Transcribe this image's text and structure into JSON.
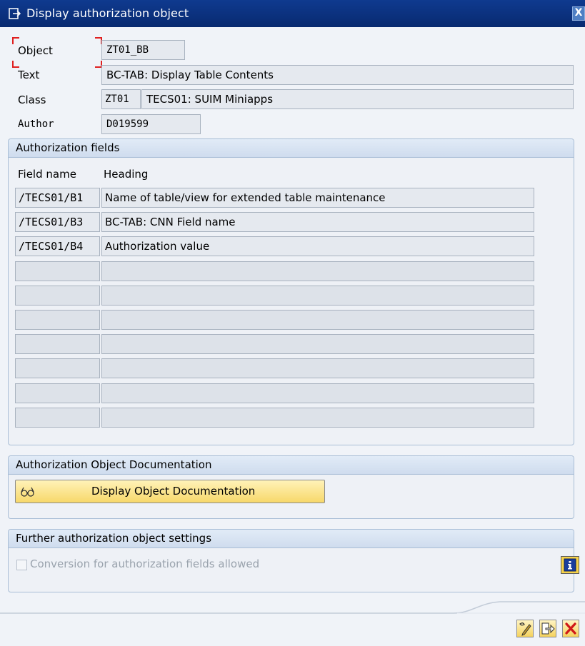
{
  "window": {
    "title": "Display authorization object",
    "close_label": "X"
  },
  "header": {
    "object_label": "Object",
    "object_value": "ZT01_BB",
    "text_label": "Text",
    "text_value": "BC-TAB: Display Table Contents",
    "class_label": "Class",
    "class_code": "ZT01",
    "class_value": "TECS01: SUIM Miniapps",
    "author_label": "Author",
    "author_value": "D019599"
  },
  "auth_fields": {
    "title": "Authorization fields",
    "col_field": "Field name",
    "col_heading": "Heading",
    "rows": [
      {
        "field": "/TECS01/B1",
        "heading": "Name of table/view for extended table maintenance"
      },
      {
        "field": "/TECS01/B3",
        "heading": "BC-TAB: CNN Field name"
      },
      {
        "field": "/TECS01/B4",
        "heading": "Authorization value"
      },
      {
        "field": "",
        "heading": ""
      },
      {
        "field": "",
        "heading": ""
      },
      {
        "field": "",
        "heading": ""
      },
      {
        "field": "",
        "heading": ""
      },
      {
        "field": "",
        "heading": ""
      },
      {
        "field": "",
        "heading": ""
      },
      {
        "field": "",
        "heading": ""
      }
    ]
  },
  "documentation": {
    "title": "Authorization Object Documentation",
    "button_label": "Display Object Documentation",
    "button_icon": "glasses-icon"
  },
  "settings": {
    "title": "Further authorization object settings",
    "checkbox_label": "Conversion for authorization fields allowed",
    "checkbox_checked": false,
    "info_icon": "info-icon"
  },
  "toolbar": {
    "buttons": [
      "edit-icon",
      "switch-icon",
      "cancel-icon"
    ]
  }
}
